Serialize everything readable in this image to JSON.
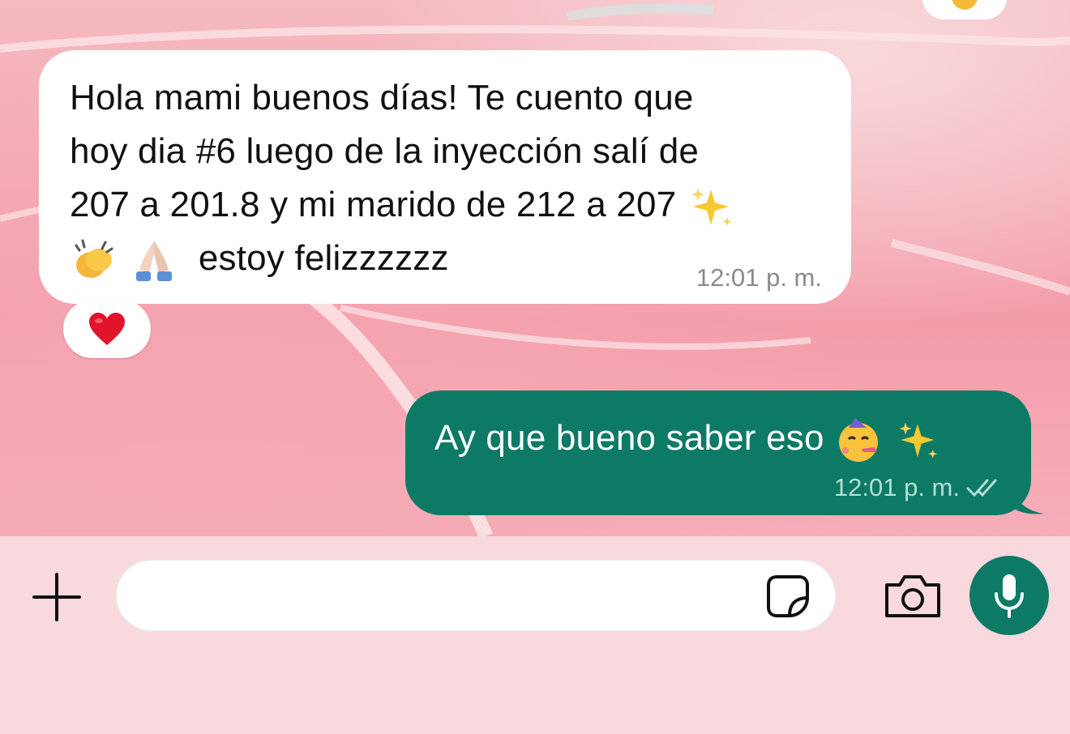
{
  "conversation": {
    "incoming_message": {
      "lines": [
        "Hola mami buenos días! Te cuento que",
        "hoy dia #6 luego de la inyección salí de",
        "207 a 201.8 y mi marido de 212 a 207"
      ],
      "last_line_text": "estoy felizzzzzz",
      "emojis_inline": [
        "sparkles",
        "clapping-hands",
        "folded-hands"
      ],
      "time": "12:01 p. m.",
      "reaction": "red-heart"
    },
    "outgoing_message": {
      "text": "Ay que bueno saber eso",
      "emojis_inline": [
        "partying-face",
        "sparkles"
      ],
      "time": "12:01 p. m.",
      "status": "read-double-check"
    }
  },
  "composer": {
    "input_value": "",
    "icons": [
      "plus-icon",
      "sticker-icon",
      "camera-icon",
      "microphone-icon"
    ]
  },
  "colors": {
    "outgoing_bubble": "#0d7a66",
    "incoming_bubble": "#ffffff",
    "mic_button": "#0d7a66",
    "wallpaper": "#f5b9c1"
  }
}
